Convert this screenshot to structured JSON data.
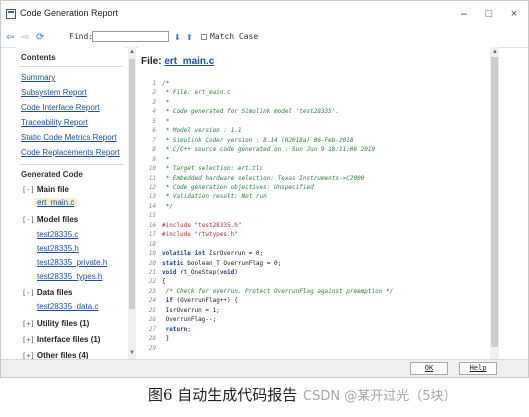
{
  "window": {
    "title": "Code Generation Report",
    "controls": {
      "minimize": "–",
      "maximize": "□",
      "close": "×"
    }
  },
  "toolbar": {
    "icons": [
      "back-arrow-icon",
      "forward-arrow-icon",
      "refresh-icon",
      "find-down-icon",
      "find-up-icon"
    ],
    "find_label": "Find:",
    "find_value": "",
    "match_case_label": "Match Case",
    "match_case_checked": false
  },
  "left": {
    "contents_heading": "Contents",
    "contents_links": [
      "Summary",
      "Subsystem Report",
      "Code Interface Report",
      "Traceability Report",
      "Static Code Metrics Report",
      "Code Replacements Report"
    ],
    "generated_code_heading": "Generated Code",
    "main_file": {
      "box": "[-]",
      "label": "Main file",
      "files": [
        "ert_main.c"
      ]
    },
    "model_files": {
      "box": "[-]",
      "label": "Model files",
      "files": [
        "test28335.c",
        "test28335.h",
        "test28335_private.h",
        "test28335_types.h"
      ]
    },
    "data_files": {
      "box": "[-]",
      "label": "Data files",
      "files": [
        "test28335_data.c"
      ]
    },
    "utility_files": {
      "box": "[+]",
      "label": "Utility files (1)"
    },
    "interface_files": {
      "box": "[+]",
      "label": "Interface files (1)"
    },
    "other_files": {
      "box": "[+]",
      "label": "Other files (4)"
    }
  },
  "content": {
    "file_prefix": "File: ",
    "file_name": "ert_main.c",
    "code_lines": [
      {
        "n": "1",
        "segs": [
          {
            "c": "comment",
            "t": "/*"
          }
        ]
      },
      {
        "n": "2",
        "segs": [
          {
            "c": "comment",
            "t": " * File: ert_main.c"
          }
        ]
      },
      {
        "n": "3",
        "segs": [
          {
            "c": "comment",
            "t": " *"
          }
        ]
      },
      {
        "n": "4",
        "segs": [
          {
            "c": "comment",
            "t": " * Code generated for Simulink model 'test28335'."
          }
        ]
      },
      {
        "n": "5",
        "segs": [
          {
            "c": "comment",
            "t": " *"
          }
        ]
      },
      {
        "n": "6",
        "segs": [
          {
            "c": "comment",
            "t": " * Model version                  : 1.1"
          }
        ]
      },
      {
        "n": "7",
        "segs": [
          {
            "c": "comment",
            "t": " * Simulink Coder version         : 8.14 (R2018a) 06-Feb-2018"
          }
        ]
      },
      {
        "n": "8",
        "segs": [
          {
            "c": "comment",
            "t": " * C/C++ source code generated on : Sun Jun  9 18:11:06 2019"
          }
        ]
      },
      {
        "n": "9",
        "segs": [
          {
            "c": "comment",
            "t": " *"
          }
        ]
      },
      {
        "n": "10",
        "segs": [
          {
            "c": "comment",
            "t": " * Target selection: ert.tlc"
          }
        ]
      },
      {
        "n": "11",
        "segs": [
          {
            "c": "comment",
            "t": " * Embedded hardware selection: Texas Instruments->C2000"
          }
        ]
      },
      {
        "n": "12",
        "segs": [
          {
            "c": "comment",
            "t": " * Code generation objectives: Unspecified"
          }
        ]
      },
      {
        "n": "13",
        "segs": [
          {
            "c": "comment",
            "t": " * Validation result: Not run"
          }
        ]
      },
      {
        "n": "14",
        "segs": [
          {
            "c": "comment",
            "t": " */"
          }
        ]
      },
      {
        "n": "15",
        "segs": []
      },
      {
        "n": "16",
        "segs": [
          {
            "c": "pre",
            "t": "#include \"test28335.h\""
          }
        ]
      },
      {
        "n": "17",
        "segs": [
          {
            "c": "pre",
            "t": "#include \"rtwtypes.h\""
          }
        ]
      },
      {
        "n": "18",
        "segs": []
      },
      {
        "n": "19",
        "segs": [
          {
            "c": "kw",
            "t": "volatile int"
          },
          {
            "c": "plain",
            "t": " IsrOverrun = 0;"
          }
        ]
      },
      {
        "n": "20",
        "segs": [
          {
            "c": "kw",
            "t": "static"
          },
          {
            "c": "plain",
            "t": " boolean_T OverrunFlag = 0;"
          }
        ]
      },
      {
        "n": "21",
        "segs": [
          {
            "c": "kw",
            "t": "void"
          },
          {
            "c": "plain",
            "t": " rt_OneStep("
          },
          {
            "c": "kw",
            "t": "void"
          },
          {
            "c": "plain",
            "t": ")"
          }
        ]
      },
      {
        "n": "22",
        "segs": [
          {
            "c": "plain",
            "t": "{"
          }
        ]
      },
      {
        "n": "23",
        "segs": [
          {
            "c": "comment",
            "t": "  /* Check for overrun. Protect OverrunFlag against preemption */"
          }
        ]
      },
      {
        "n": "24",
        "segs": [
          {
            "c": "plain",
            "t": "  "
          },
          {
            "c": "kw",
            "t": "if"
          },
          {
            "c": "plain",
            "t": " (OverrunFlag++) {"
          }
        ]
      },
      {
        "n": "25",
        "segs": [
          {
            "c": "plain",
            "t": "    IsrOverrun = 1;"
          }
        ]
      },
      {
        "n": "26",
        "segs": [
          {
            "c": "plain",
            "t": "    OverrunFlag--;"
          }
        ]
      },
      {
        "n": "27",
        "segs": [
          {
            "c": "plain",
            "t": "    "
          },
          {
            "c": "kw",
            "t": "return"
          },
          {
            "c": "plain",
            "t": ";"
          }
        ]
      },
      {
        "n": "28",
        "segs": [
          {
            "c": "plain",
            "t": "  }"
          }
        ]
      },
      {
        "n": "29",
        "segs": []
      }
    ]
  },
  "buttons": {
    "ok": "OK",
    "help": "Help"
  },
  "caption": "图6  自动生成代码报告",
  "watermark": "CSDN @某开过光（5块）",
  "colors": {
    "link": "#1f4fa8",
    "selected_bg": "#f4efcc",
    "comment": "#2f7d3c",
    "preprocessor": "#a8332f",
    "keyword": "#1f3c8f"
  }
}
